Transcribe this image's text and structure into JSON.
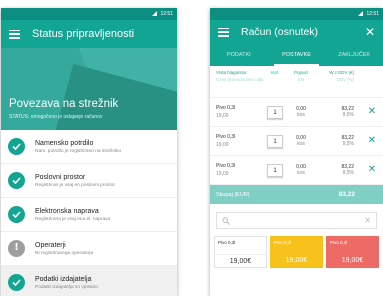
{
  "status_screen": {
    "status_time": "12:51",
    "title": "Status pripravljenosti",
    "hero_title": "Povezava na strežnik",
    "hero_subtitle": "STATUS: omogočeno je izdajanje računov",
    "items": [
      {
        "title": "Namensko potrdilo",
        "subtitle": "Nam. potrdilo je registrirano na strežniku",
        "state": "ok"
      },
      {
        "title": "Poslovni prostor",
        "subtitle": "Registriran je vsaj en poslovni prostor",
        "state": "ok"
      },
      {
        "title": "Elektronska naprava",
        "subtitle": "Registrirana je vsaj ena el. naprava",
        "state": "ok"
      },
      {
        "title": "Operaterji",
        "subtitle": "Ni registriranega operaterja",
        "state": "warning"
      },
      {
        "title": "Podatki izdajatelja",
        "subtitle": "Podatki izdajatelja so vpisano",
        "state": "ok"
      }
    ]
  },
  "invoice_screen": {
    "status_time": "12:51",
    "title": "Račun (osnutek)",
    "tabs": [
      "PODATKI",
      "POSTAVKE",
      "ZAKLJUČEK"
    ],
    "active_tab": "POSTAVKE",
    "columns": {
      "item": "Vrsta blaga/stor.",
      "item_sub": "Cena (€)/enota brez ddv",
      "qty": "Kol.",
      "discount": "Popust",
      "discount_sub": "EM",
      "total": "W z DDV (€)",
      "total_sub": "DDV (%)"
    },
    "rows": [
      {
        "name": "Pivo 0,3l",
        "price": "19,00",
        "qty": "1",
        "discount": "0,00",
        "unit": "kos",
        "amount": "83,22",
        "vat": "9,5%"
      },
      {
        "name": "Pivo 0,3l",
        "price": "19,00",
        "qty": "1",
        "discount": "0,00",
        "unit": "kos",
        "amount": "83,22",
        "vat": "9,5%"
      },
      {
        "name": "Pivo 0,3l",
        "price": "19,00",
        "qty": "1",
        "discount": "0,00",
        "unit": "kos",
        "amount": "83,22",
        "vat": "9,5%"
      }
    ],
    "total_label": "Skupaj (EUR)",
    "total_value": "83,22",
    "tiles": [
      {
        "name": "Pivo 0,3l",
        "price": "19,00€"
      },
      {
        "name": "Pivo 0,3l",
        "price": "19,00€"
      },
      {
        "name": "Pivo 0,3l",
        "price": "19,00€"
      }
    ]
  },
  "colors": {
    "primary": "#13a594",
    "dark": "#0d8e82",
    "yellow": "#f6c21b",
    "red": "#ee6a66",
    "light_teal": "#7fcfc4"
  }
}
